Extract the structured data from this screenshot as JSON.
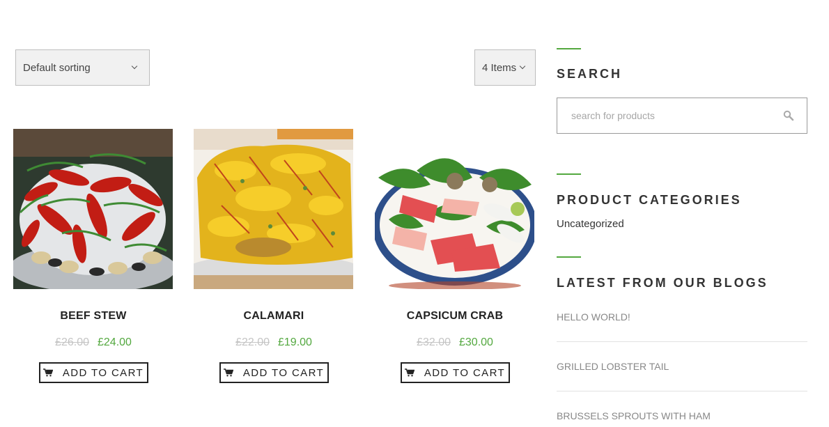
{
  "toolbar": {
    "sort_label": "Default sorting",
    "items_label": "4 Items"
  },
  "products": [
    {
      "name": "BEEF STEW",
      "old_price": "£26.00",
      "new_price": "£24.00",
      "button_label": "ADD TO CART"
    },
    {
      "name": "CALAMARI",
      "old_price": "£22.00",
      "new_price": "£19.00",
      "button_label": "ADD TO CART"
    },
    {
      "name": "CAPSICUM CRAB",
      "old_price": "£32.00",
      "new_price": "£30.00",
      "button_label": "ADD TO CART"
    }
  ],
  "sidebar": {
    "search": {
      "title": "SEARCH",
      "placeholder": "search for products"
    },
    "categories": {
      "title": "PRODUCT CATEGORIES",
      "items": [
        "Uncategorized"
      ]
    },
    "blogs": {
      "title": "LATEST FROM OUR BLOGS",
      "items": [
        "HELLO WORLD!",
        "GRILLED LOBSTER TAIL",
        "BRUSSELS SPROUTS WITH HAM"
      ]
    }
  },
  "colors": {
    "accent": "#53a83f",
    "old_price": "#c4c4c4",
    "text_dark": "#222222"
  },
  "icons": {
    "cart": "shopping-cart-icon",
    "search": "magnifier-icon",
    "dropdown": "chevron-down-icon"
  }
}
